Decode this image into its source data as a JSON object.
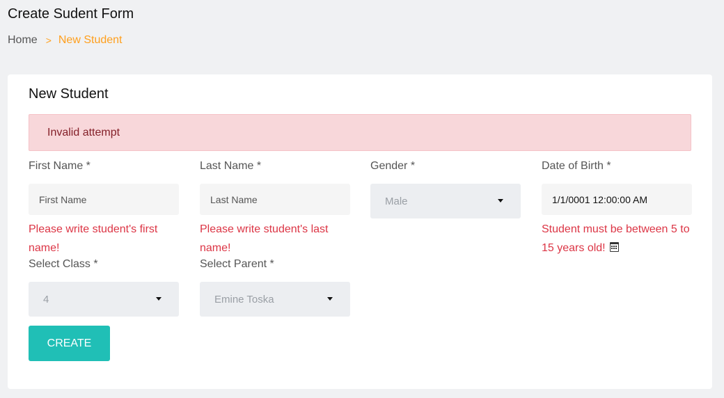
{
  "page": {
    "title": "Create Sudent Form",
    "breadcrumb": {
      "home": "Home",
      "separator": ">",
      "current": "New Student"
    }
  },
  "form": {
    "title": "New Student",
    "alert": "Invalid attempt",
    "first_name": {
      "label": "First Name *",
      "placeholder": "First Name",
      "value": "",
      "error": "Please write student's first name!"
    },
    "last_name": {
      "label": "Last Name *",
      "placeholder": "Last Name",
      "value": "",
      "error": "Please write student's last name!"
    },
    "gender": {
      "label": "Gender *",
      "selected": "Male"
    },
    "date_of_birth": {
      "label": "Date of Birth *",
      "value": "1/1/0001 12:00:00 AM",
      "error": "Student must be between 5 to 15 years old!"
    },
    "class": {
      "label": "Select Class *",
      "selected": "4"
    },
    "parent": {
      "label": "Select Parent *",
      "selected": "Emine Toska"
    },
    "submit_label": "CREATE"
  },
  "colors": {
    "accent": "#20bfb6",
    "breadcrumb_active": "#ff9f1c",
    "error": "#dc3545",
    "alert_bg": "#f8d7da"
  },
  "icons": {
    "breadcrumb_separator": "chevron-right-icon",
    "calendar": "calendar-icon",
    "select_caret": "caret-down-icon"
  }
}
